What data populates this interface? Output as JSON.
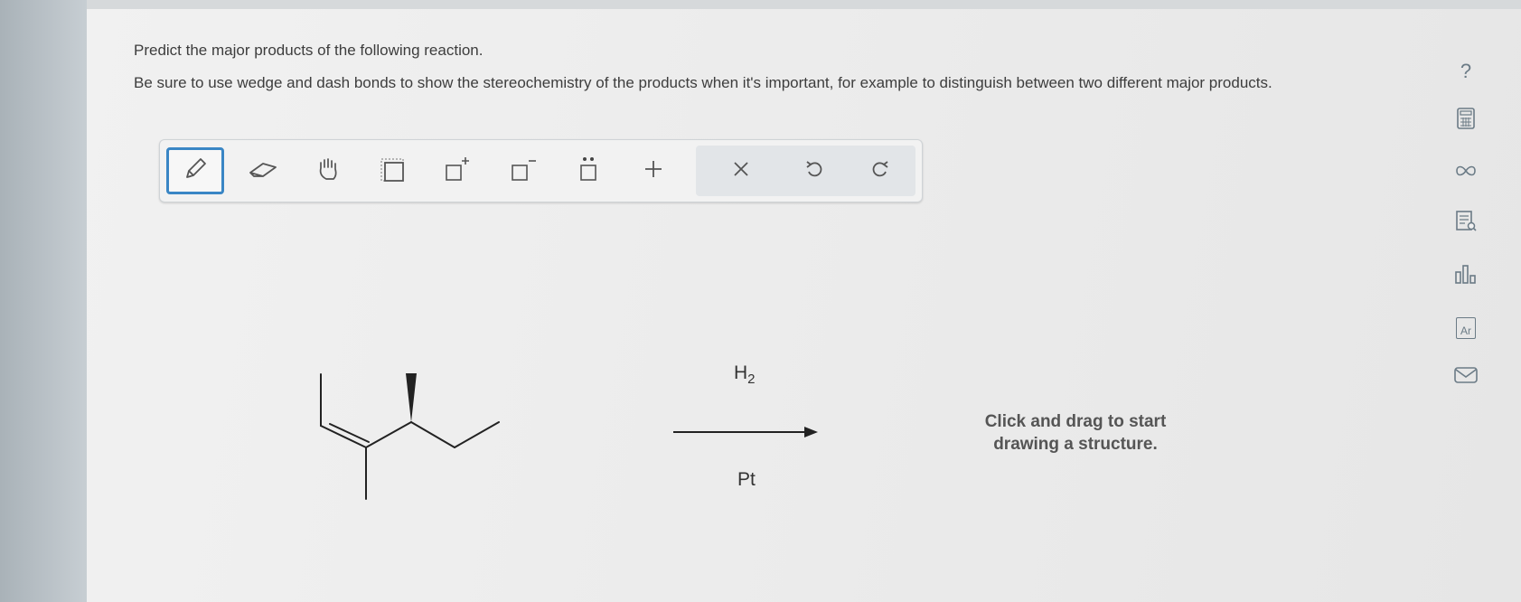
{
  "question": {
    "prompt": "Predict the major products of the following reaction.",
    "instructions": "Be sure to use wedge and dash bonds to show the stereochemistry of the products when it's important, for example to distinguish between two different major products."
  },
  "toolbar": {
    "tools": [
      {
        "name": "pencil-icon",
        "active": true
      },
      {
        "name": "eraser-icon"
      },
      {
        "name": "hand-icon"
      },
      {
        "name": "select-box-icon"
      },
      {
        "name": "positive-charge-icon"
      },
      {
        "name": "negative-charge-icon"
      },
      {
        "name": "lone-pair-icon"
      },
      {
        "name": "add-icon"
      },
      {
        "name": "clear-icon"
      },
      {
        "name": "undo-icon"
      },
      {
        "name": "redo-icon"
      }
    ]
  },
  "reaction": {
    "reagent_above": "H",
    "reagent_above_subscript": "2",
    "reagent_below": "Pt"
  },
  "canvas": {
    "hint": "Click and drag to start drawing a structure."
  },
  "sidebar": {
    "help_label": "?",
    "periodic_label": "Ar"
  },
  "colors": {
    "accent": "#3a86c5",
    "icon": "#6b7b86"
  }
}
